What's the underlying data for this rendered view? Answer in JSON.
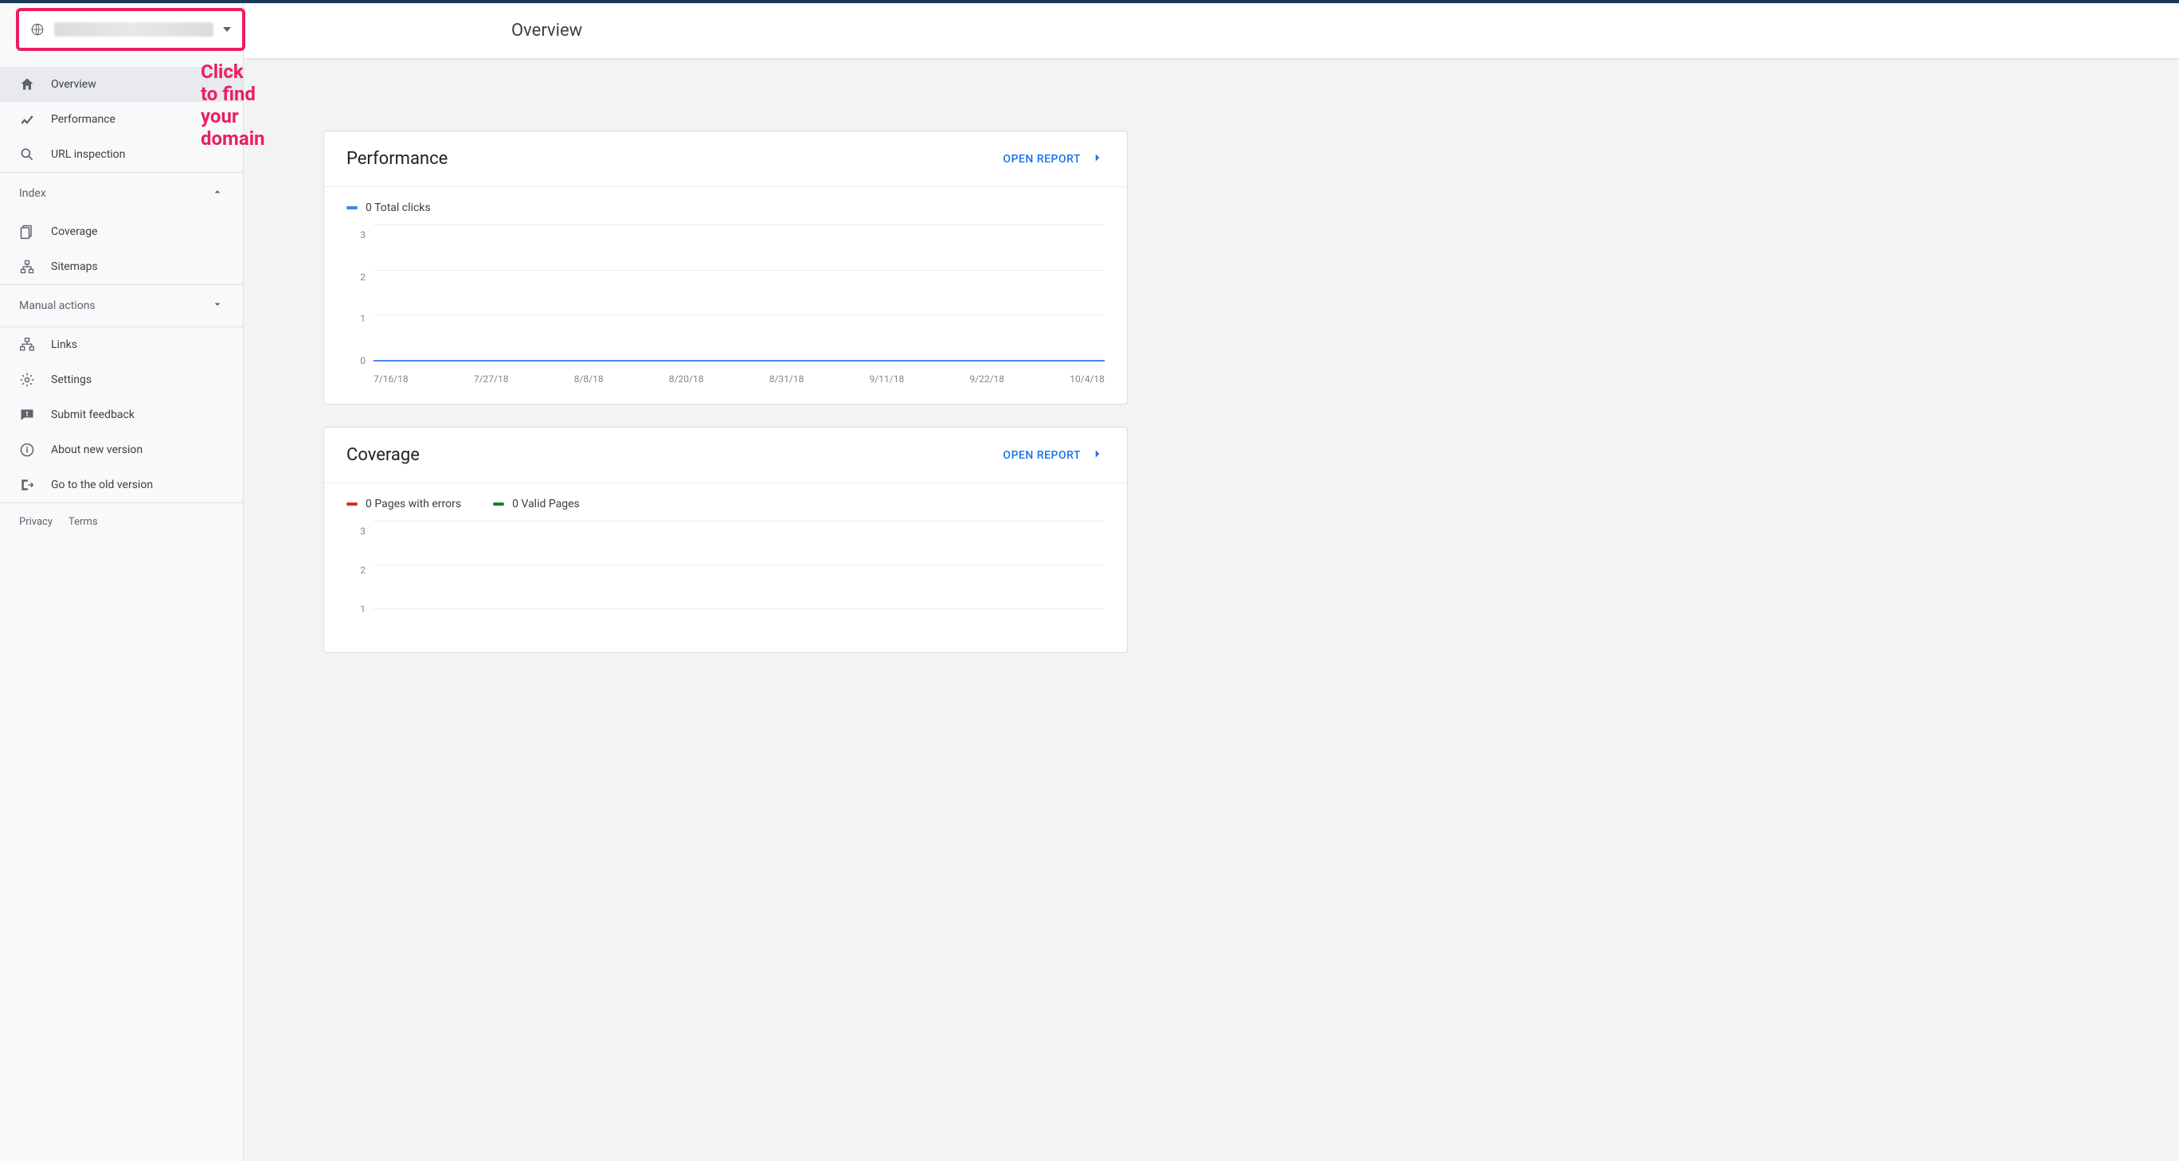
{
  "header": {
    "page_title": "Overview",
    "property_label_redacted": true,
    "hint_text": "Click to find your domain"
  },
  "sidebar": {
    "items": [
      {
        "label": "Overview",
        "icon": "home"
      },
      {
        "label": "Performance",
        "icon": "trend"
      },
      {
        "label": "URL inspection",
        "icon": "search"
      }
    ],
    "sections": [
      {
        "label": "Index",
        "expanded": true,
        "items": [
          {
            "label": "Coverage",
            "icon": "pages"
          },
          {
            "label": "Sitemaps",
            "icon": "tree"
          }
        ]
      },
      {
        "label": "Manual actions",
        "expanded": false,
        "items": []
      }
    ],
    "links_items": [
      {
        "label": "Links",
        "icon": "links"
      },
      {
        "label": "Settings",
        "icon": "gear"
      }
    ],
    "bottom": [
      {
        "label": "Submit feedback",
        "icon": "feedback"
      },
      {
        "label": "About new version",
        "icon": "info"
      },
      {
        "label": "Go to the old version",
        "icon": "exit"
      }
    ],
    "legal": {
      "privacy": "Privacy",
      "terms": "Terms"
    }
  },
  "cards": {
    "performance": {
      "title": "Performance",
      "open_report": "OPEN REPORT",
      "legend": [
        {
          "label": "0 Total clicks",
          "color": "#4285f4"
        }
      ]
    },
    "coverage": {
      "title": "Coverage",
      "open_report": "OPEN REPORT",
      "legend": [
        {
          "label": "0 Pages with errors",
          "color": "#d93025"
        },
        {
          "label": "0 Valid Pages",
          "color": "#188038"
        }
      ]
    }
  },
  "chart_data": [
    {
      "name": "performance",
      "type": "line",
      "title": "Performance",
      "ylabel": "Total clicks",
      "ylim": [
        0,
        3
      ],
      "yticks": [
        0,
        1,
        2,
        3
      ],
      "categories": [
        "7/16/18",
        "7/27/18",
        "8/8/18",
        "8/20/18",
        "8/31/18",
        "9/11/18",
        "9/22/18",
        "10/4/18"
      ],
      "series": [
        {
          "name": "Total clicks",
          "color": "#4285f4",
          "values": [
            0,
            0,
            0,
            0,
            0,
            0,
            0,
            0
          ]
        }
      ]
    },
    {
      "name": "coverage",
      "type": "line",
      "title": "Coverage",
      "ylabel": "Pages",
      "ylim": [
        0,
        3
      ],
      "yticks": [
        1,
        2,
        3
      ],
      "categories": [],
      "series": [
        {
          "name": "Pages with errors",
          "color": "#d93025",
          "values": []
        },
        {
          "name": "Valid Pages",
          "color": "#188038",
          "values": []
        }
      ]
    }
  ]
}
